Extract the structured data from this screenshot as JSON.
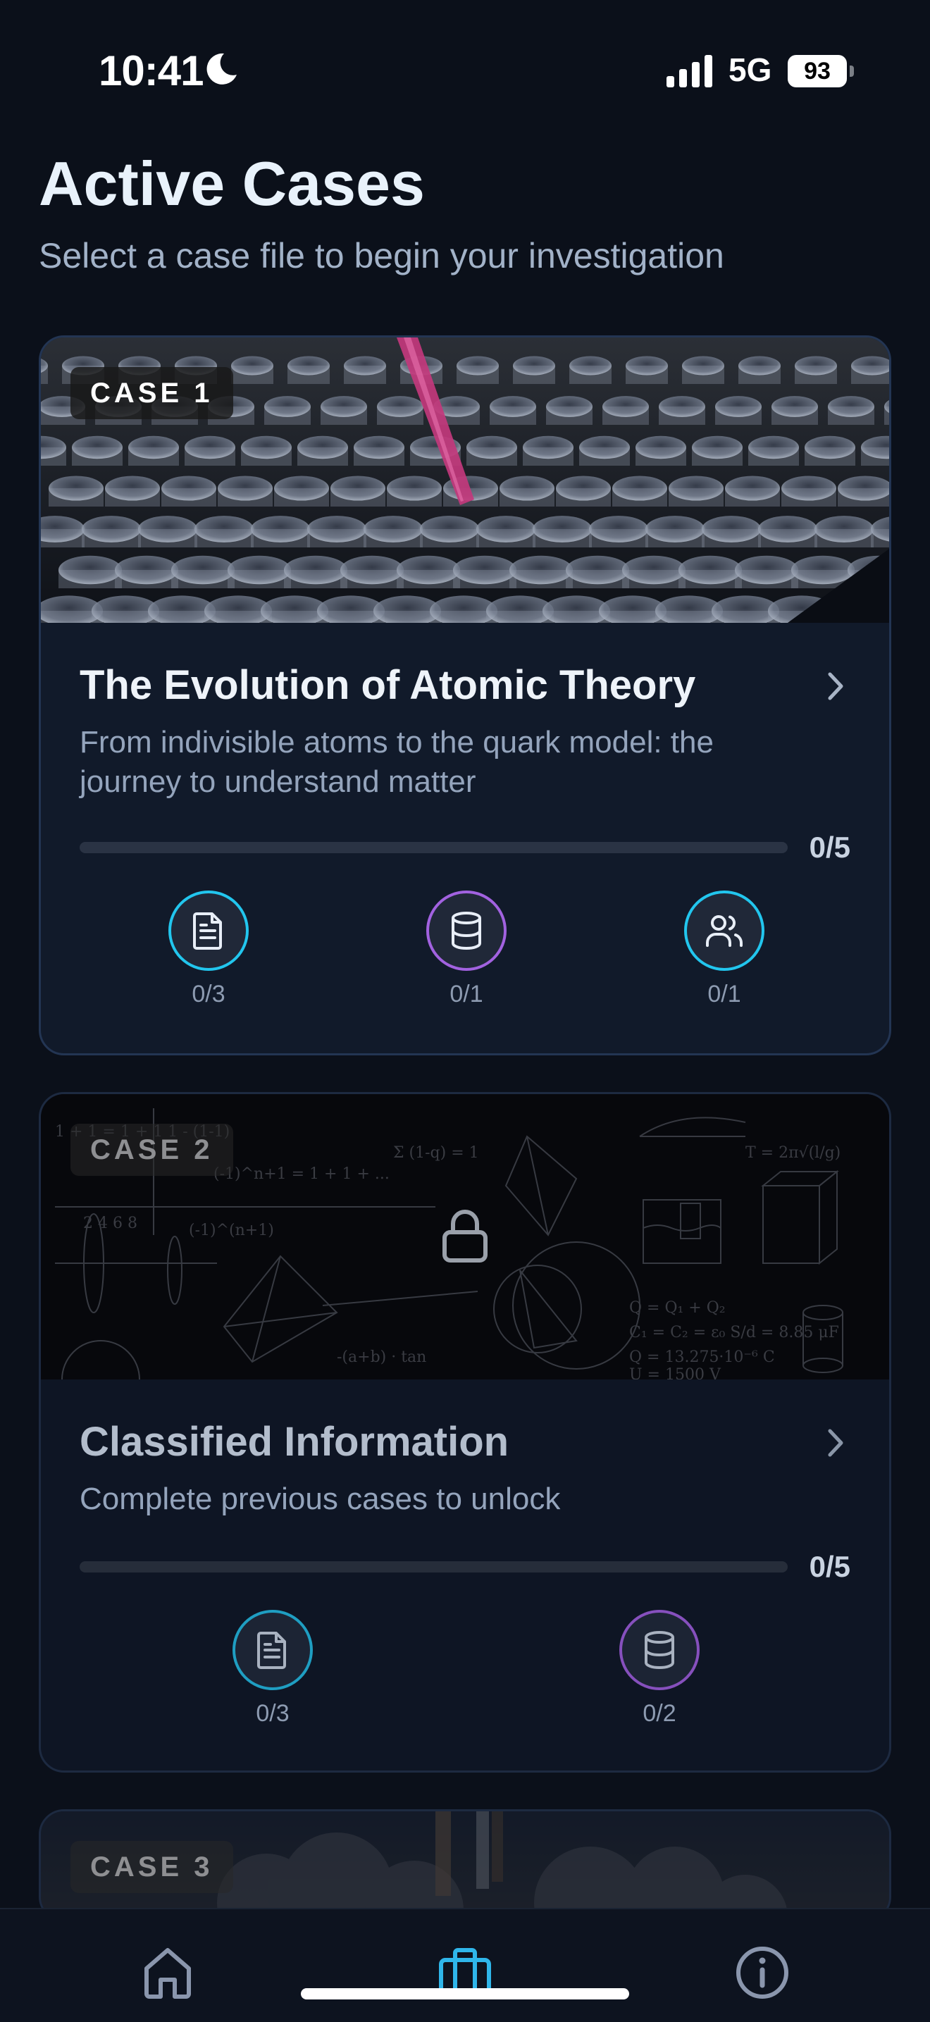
{
  "status_bar": {
    "time": "10:41",
    "network": "5G",
    "battery": "93"
  },
  "header": {
    "title": "Active Cases",
    "subtitle": "Select a case file to begin your investigation"
  },
  "cases": [
    {
      "badge": "CASE 1",
      "title": "The Evolution of Atomic Theory",
      "description": "From indivisible atoms to the quark model: the journey to understand matter",
      "progress_text": "0/5",
      "progress_fraction": 0,
      "stats": [
        {
          "icon": "document-icon",
          "count": "0/3",
          "color": "#22c6ee"
        },
        {
          "icon": "database-icon",
          "count": "0/1",
          "color": "#a262e0"
        },
        {
          "icon": "users-icon",
          "count": "0/1",
          "color": "#22c6ee"
        }
      ]
    },
    {
      "badge": "CASE 2",
      "title": "Classified Information",
      "description": "Complete previous cases to unlock",
      "locked": true,
      "progress_text": "0/5",
      "progress_fraction": 0,
      "stats": [
        {
          "icon": "document-icon",
          "count": "0/3",
          "color": "#1f9ec2"
        },
        {
          "icon": "database-icon",
          "count": "0/2",
          "color": "#8650bd"
        }
      ],
      "banner_formulas": [
        "T = 2π√(l/g)",
        "Q = Q₁ + Q₂",
        "U = 1500 V",
        "C₁ = C₂"
      ]
    },
    {
      "badge": "CASE 3"
    }
  ],
  "bottom_nav": {
    "items": [
      {
        "icon": "home-icon",
        "active": false
      },
      {
        "icon": "briefcase-icon",
        "active": true
      },
      {
        "icon": "info-icon",
        "active": false
      }
    ],
    "active_color": "#2fb6ea"
  }
}
